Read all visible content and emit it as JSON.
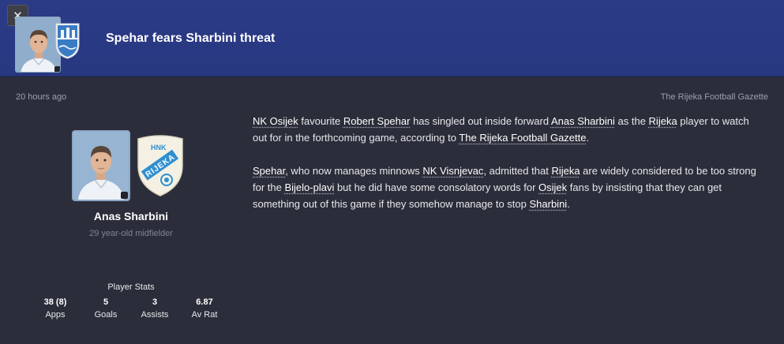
{
  "header": {
    "close_label": "✕",
    "title": "Spehar fears Sharbini threat"
  },
  "meta": {
    "time": "20 hours ago",
    "source": "The Rijeka Football Gazette"
  },
  "crest": {
    "top_text": "HNK",
    "club_text": "RIJEKA"
  },
  "player": {
    "name": "Anas Sharbini",
    "description": "29 year-old midfielder"
  },
  "stats": {
    "title": "Player Stats",
    "items": [
      {
        "value": "38 (8)",
        "label": "Apps"
      },
      {
        "value": "5",
        "label": "Goals"
      },
      {
        "value": "3",
        "label": "Assists"
      },
      {
        "value": "6.87",
        "label": "Av Rat"
      }
    ]
  },
  "article": {
    "p1": [
      {
        "t": "NK Osijek",
        "link": true
      },
      {
        "t": " favourite ",
        "link": false
      },
      {
        "t": "Robert Spehar",
        "link": true
      },
      {
        "t": " has singled out inside forward ",
        "link": false
      },
      {
        "t": "Anas Sharbini",
        "link": true
      },
      {
        "t": " as the ",
        "link": false
      },
      {
        "t": "Rijeka",
        "link": true
      },
      {
        "t": " player to watch out for in the forthcoming game, according to ",
        "link": false
      },
      {
        "t": "The Rijeka Football Gazette",
        "link": true
      },
      {
        "t": ".",
        "link": false
      }
    ],
    "p2": [
      {
        "t": "Spehar",
        "link": true
      },
      {
        "t": ", who now manages minnows ",
        "link": false
      },
      {
        "t": "NK Visnjevac",
        "link": true
      },
      {
        "t": ", admitted that ",
        "link": false
      },
      {
        "t": "Rijeka",
        "link": true
      },
      {
        "t": " are widely considered to be too strong for the ",
        "link": false
      },
      {
        "t": "Bijelo-plavi",
        "link": true
      },
      {
        "t": " but he did have some consolatory words for ",
        "link": false
      },
      {
        "t": "Osijek",
        "link": true
      },
      {
        "t": " fans by insisting that they can get something out of this game if they somehow manage to stop ",
        "link": false
      },
      {
        "t": "Sharbini",
        "link": true
      },
      {
        "t": ".",
        "link": false
      }
    ]
  },
  "colors": {
    "header_bg": "#2b3b86",
    "page_bg": "#2b2e3a",
    "crest_blue": "#2f8fd0"
  }
}
